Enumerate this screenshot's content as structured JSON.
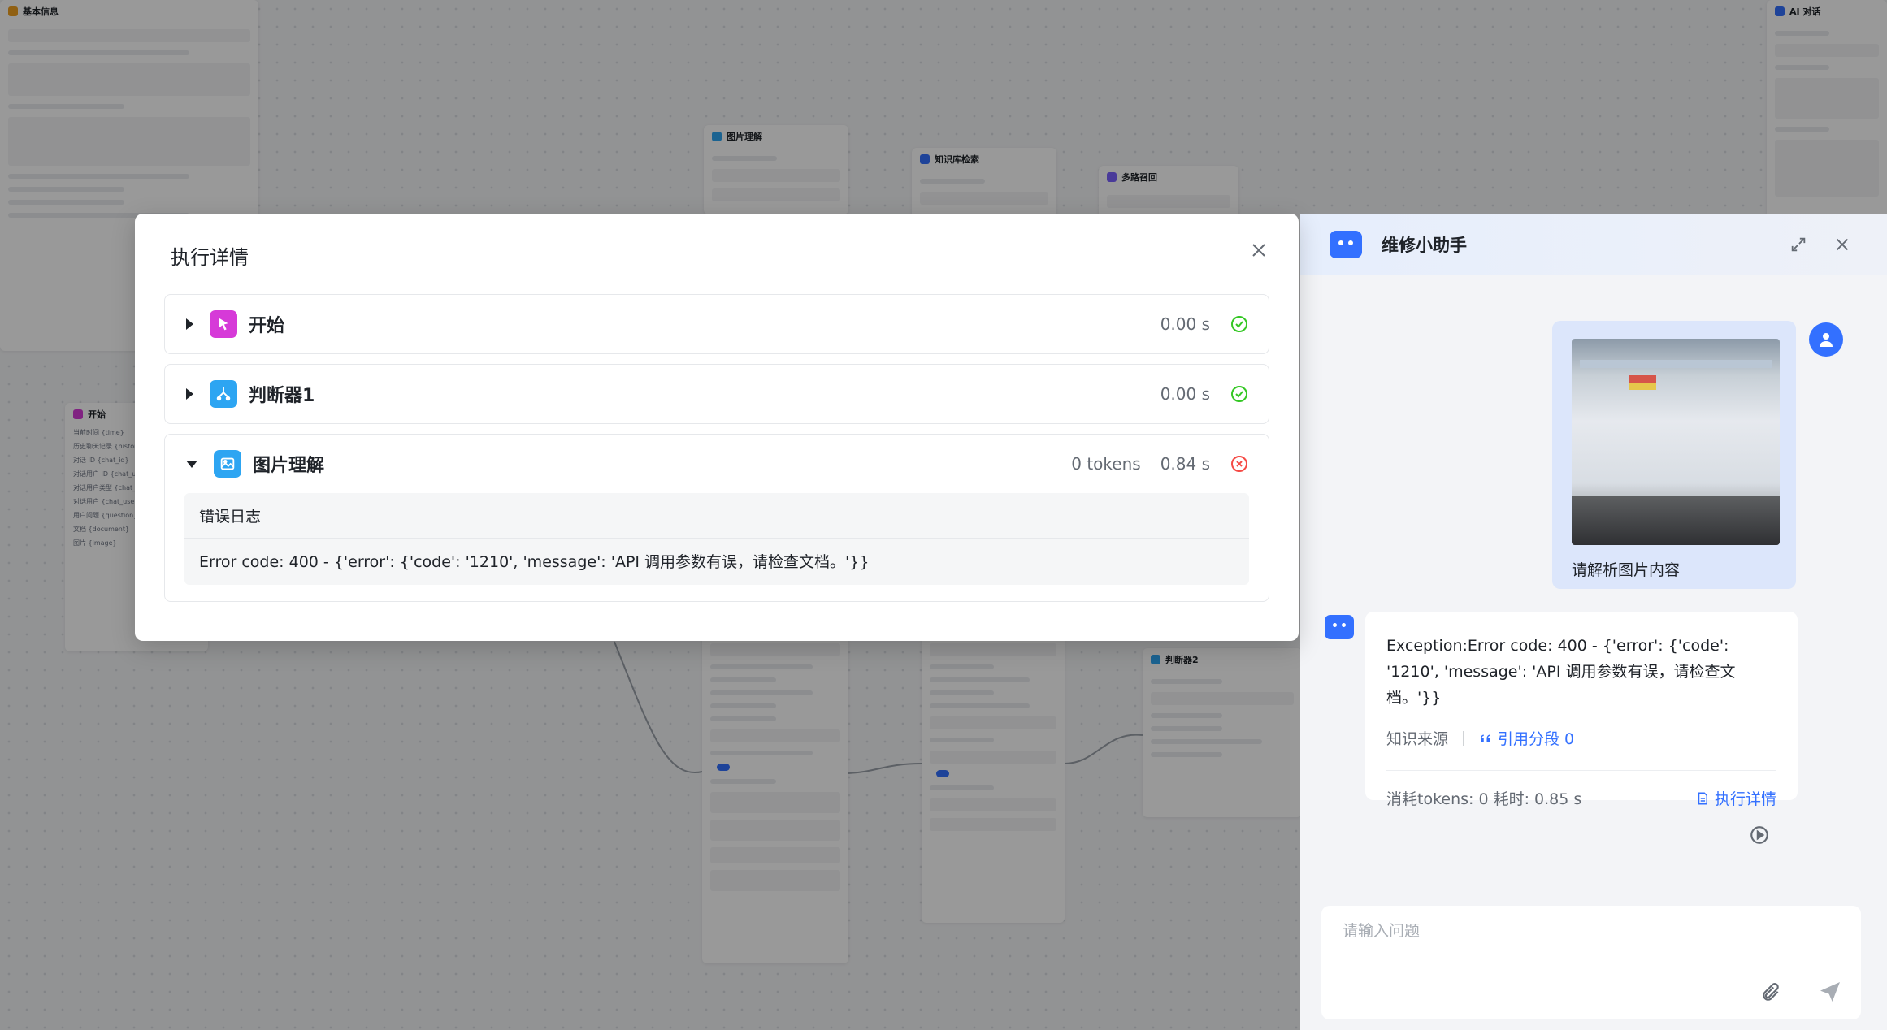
{
  "modal": {
    "title": "执行详情",
    "steps": [
      {
        "name": "开始",
        "tokens": "",
        "time": "0.00 s",
        "status": "success"
      },
      {
        "name": "判断器1",
        "tokens": "",
        "time": "0.00 s",
        "status": "success"
      },
      {
        "name": "图片理解",
        "tokens": "0 tokens",
        "time": "0.84 s",
        "status": "error",
        "log_title": "错误日志",
        "log_text": "Error code: 400 - {'error': {'code': '1210', 'message': 'API 调用参数有误，请检查文档。'}}"
      }
    ]
  },
  "chat": {
    "title": "维修小助手",
    "user_message": "请解析图片内容",
    "bot_message": "Exception:Error code: 400 - {'error': {'code': '1210', 'message': 'API 调用参数有误，请检查文档。'}}",
    "knowledge_label": "知识来源",
    "cite_label": "引用分段 0",
    "usage": "消耗tokens: 0  耗时: 0.85 s",
    "details_link": "执行详情",
    "input_placeholder": "请输入问题"
  },
  "canvas": {
    "left_panel_title": "基本信息",
    "image_node": "图片理解",
    "kb_node": "知识库检索",
    "multi_node": "多路召回",
    "ai_node": "AI 对话",
    "start_node": "开始",
    "judge_node": "判断器2",
    "start_fields": [
      "当前时间 {time}",
      "历史聊天记录 {history}",
      "对话 ID {chat_id}",
      "对话用户 ID {chat_user}",
      "对话用户类型 {chat_type}",
      "对话用户 {chat_user}"
    ],
    "start_outputs": [
      "用户问题 {question}",
      "文档 {document}",
      "图片 {image}"
    ],
    "colors": {
      "accent": "#3370ff",
      "success": "#34c724",
      "error": "#f54a45",
      "start": "#d63ad8",
      "judge": "#2da5f2",
      "image": "#2da5f2"
    }
  }
}
